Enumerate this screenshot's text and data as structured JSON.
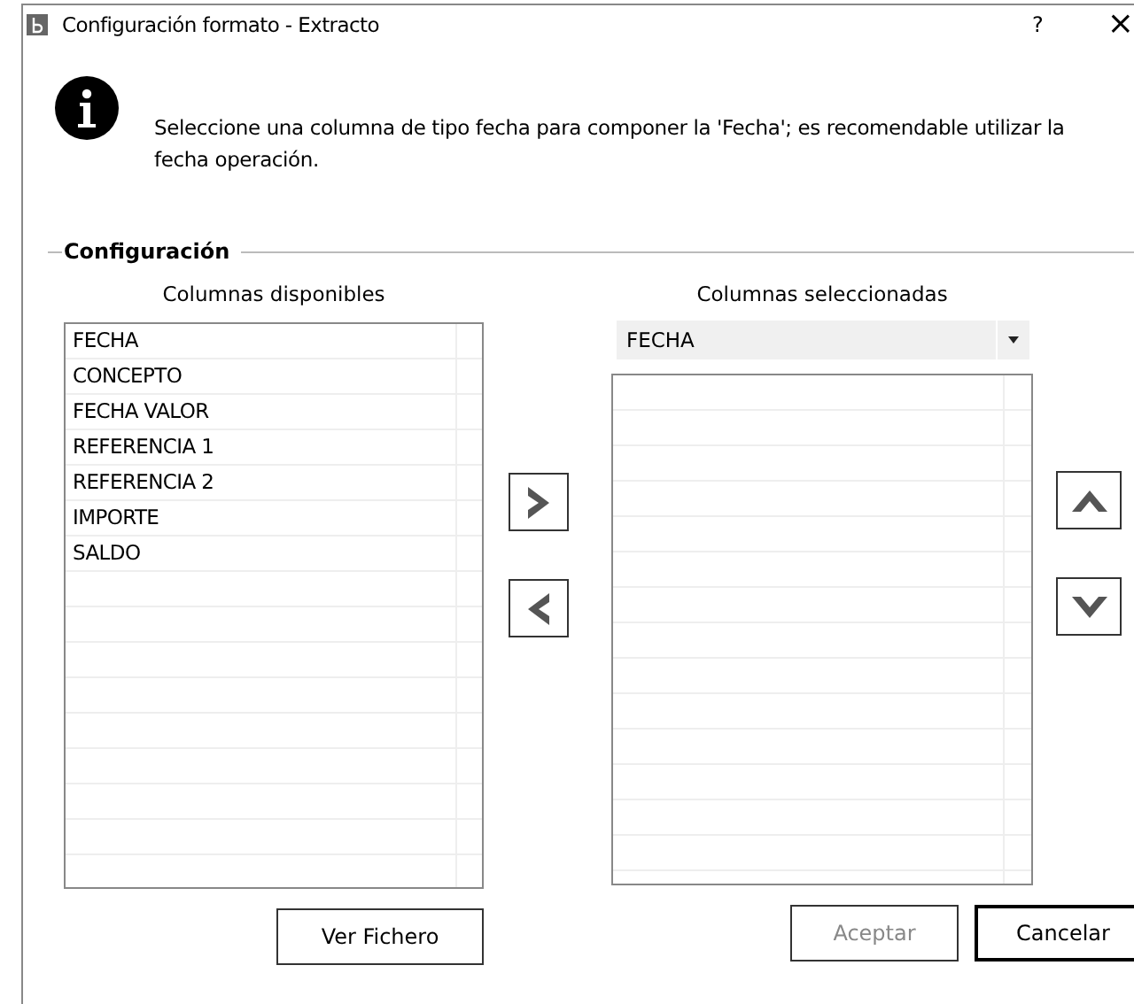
{
  "window": {
    "title": "Configuración formato - Extracto",
    "help": "?",
    "close": "×"
  },
  "message": "Seleccione una columna de tipo fecha para componer la 'Fecha'; es recomendable utilizar la fecha operación.",
  "group": {
    "label": "Configuración"
  },
  "available": {
    "heading": "Columnas disponibles",
    "items": [
      "FECHA",
      "CONCEPTO",
      "FECHA VALOR",
      "REFERENCIA 1",
      "REFERENCIA 2",
      "IMPORTE",
      "SALDO"
    ],
    "button": "Ver Fichero"
  },
  "selected": {
    "heading": "Columnas seleccionadas",
    "dropdown": "FECHA"
  },
  "buttons": [
    {
      "label": "Aceptar",
      "disabled": true,
      "default": false
    },
    {
      "label": "Cancelar",
      "disabled": false,
      "default": true
    }
  ]
}
